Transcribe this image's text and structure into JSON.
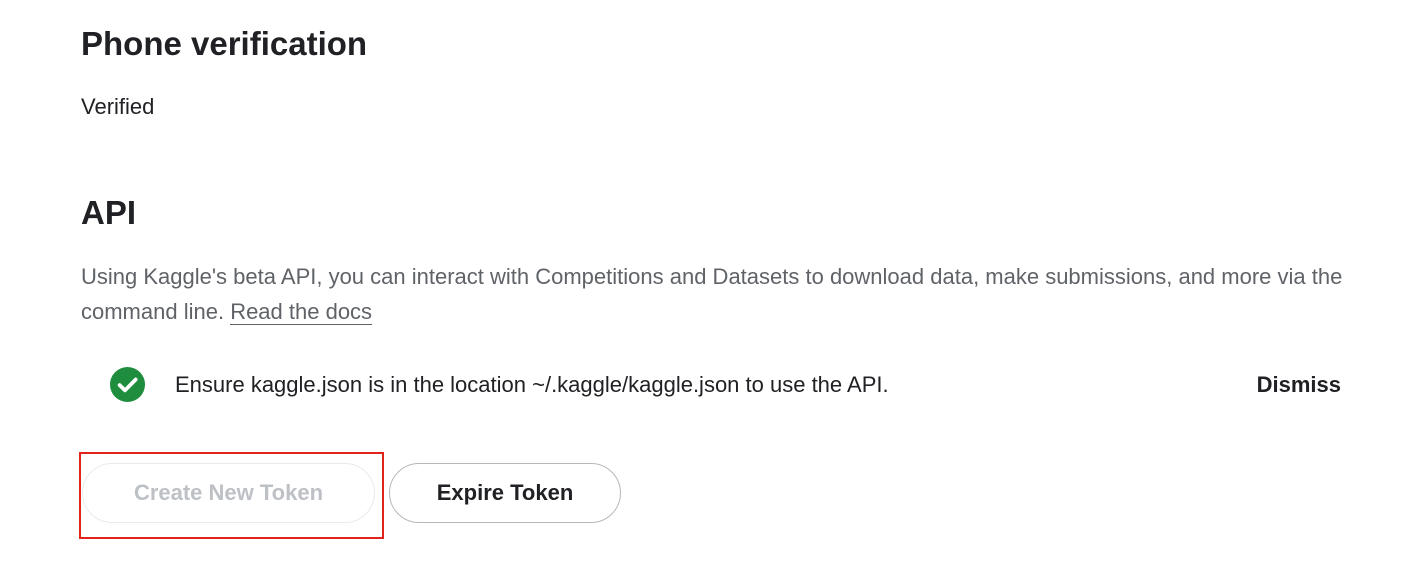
{
  "phone_verification": {
    "title": "Phone verification",
    "status": "Verified"
  },
  "api": {
    "title": "API",
    "description": "Using Kaggle's beta API, you can interact with Competitions and Datasets to download data, make submissions, and more via the command line. ",
    "docs_link": "Read the docs",
    "notice": {
      "icon": "check-circle-icon",
      "icon_color": "#1e8e3e",
      "text": "Ensure kaggle.json is in the location ~/.kaggle/kaggle.json to use the API.",
      "dismiss_label": "Dismiss"
    },
    "buttons": {
      "create_token_label": "Create New Token",
      "create_token_state": "disabled",
      "expire_token_label": "Expire Token"
    }
  },
  "annotation": {
    "highlight_color": "#e2231a"
  }
}
